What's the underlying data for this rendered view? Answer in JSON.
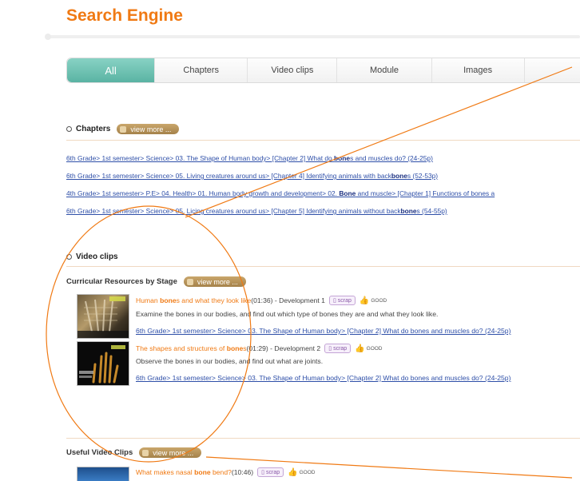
{
  "header": {
    "title": "Search Engine"
  },
  "tabs": [
    {
      "label": "All",
      "active": true
    },
    {
      "label": "Chapters"
    },
    {
      "label": "Video clips"
    },
    {
      "label": "Module"
    },
    {
      "label": "Images"
    },
    {
      "label": ""
    }
  ],
  "chapters": {
    "heading": "Chapters",
    "view_more": "view more ...",
    "items": [
      {
        "pre": "6th Grade> 1st semester> Science> 03. The Shape of Human body> [Chapter 2] What do ",
        "keyword": "bone",
        "post": "s and muscles do? (24-25p)"
      },
      {
        "pre": "6th Grade> 1st semester> Science> 05. Living creatures around us> [Chapter 4] Identifying animals with back",
        "keyword": "bone",
        "post": "s (52-53p)"
      },
      {
        "pre": "4th Grade> 1st semester> P.E> 04. Health> 01. Human body growth and development> 02. ",
        "keyword": "Bone",
        "post": " and muscle> [Chapter 1] Functions of bones a"
      },
      {
        "pre": "6th Grade> 1st semester> Science> 05. Licing creatures around us> [Chapter 5] Identifying animals without back",
        "keyword": "bone",
        "post": "s (54-55p)"
      }
    ]
  },
  "video_clips": {
    "heading": "Video clips",
    "curricular": {
      "heading": "Curricular Resources by Stage",
      "view_more": "view more ...",
      "items": [
        {
          "title_pre": "Human ",
          "title_kw": "bone",
          "title_post": "s and what they look like",
          "meta": " (01:36) - Development 1",
          "scrap": "scrap",
          "good": "GOOD",
          "description": "Examine the bones in our bodies, and find out which type of bones they are and what they look like.",
          "path": "6th Grade> 1st semester> Science> 03. The Shape of Human body> [Chapter 2] What do bones and muscles do? (24-25p)"
        },
        {
          "title_pre": "The shapes and structures of ",
          "title_kw": "bone",
          "title_post": "s",
          "meta": " (01:29) - Development 2",
          "scrap": "scrap",
          "good": "GOOD",
          "description": "Observe the bones in our bodies, and find out what are joints.",
          "path": "6th Grade> 1st semester> Science> 03. The Shape of Human body> [Chapter 2] What do bones and muscles do? (24-25p)"
        }
      ]
    },
    "useful": {
      "heading": "Useful Video Clips",
      "view_more": "view more ...",
      "items": [
        {
          "title_pre": "What makes nasal ",
          "title_kw": "bone",
          "title_post": " bend?",
          "meta": " (10:46)",
          "scrap": "scrap",
          "good": "GOOD"
        }
      ]
    }
  },
  "colors": {
    "accent": "#f07a14",
    "tab_active": "#6cc0b0",
    "link": "#2e4fa8",
    "annotation": "#f07a14"
  }
}
